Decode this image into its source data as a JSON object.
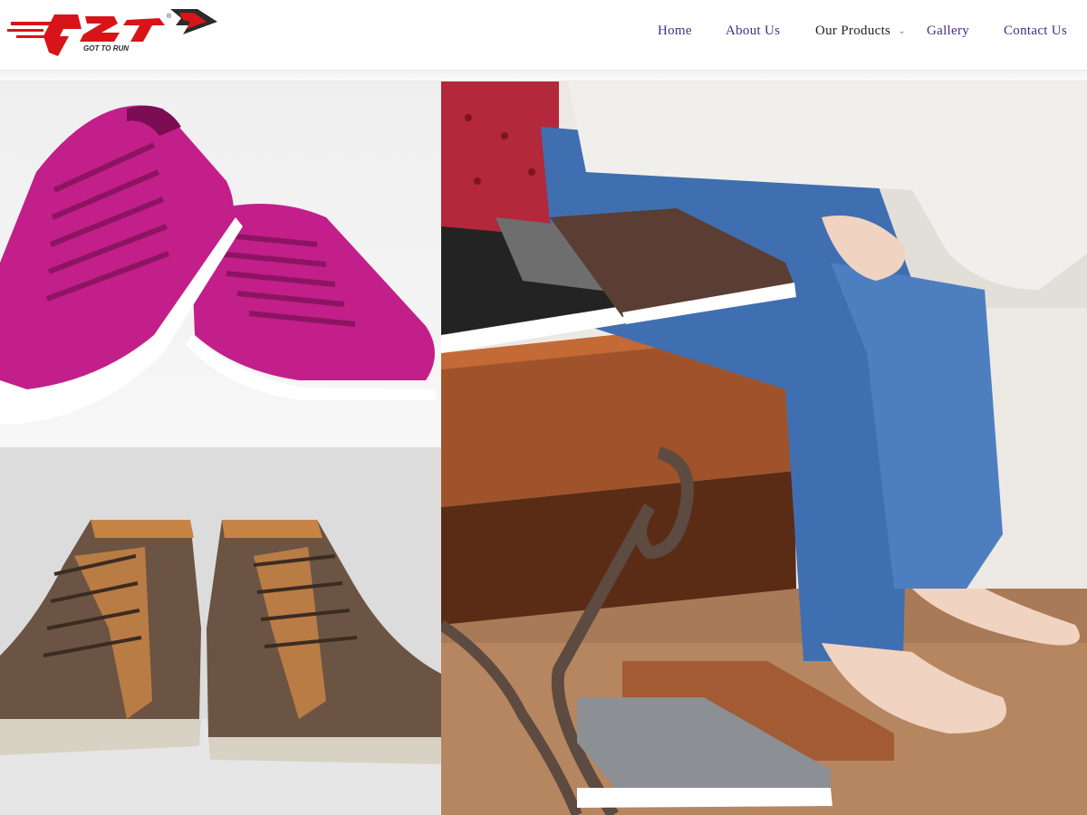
{
  "brand": {
    "logo_text": "G2R",
    "tagline": "GOT TO RUN",
    "registered_mark": "®"
  },
  "nav": {
    "items": [
      {
        "label": "Home"
      },
      {
        "label": "About Us"
      },
      {
        "label": "Our Products",
        "has_dropdown": true,
        "active": true
      },
      {
        "label": "Gallery"
      },
      {
        "label": "Contact Us"
      }
    ],
    "link_color": "#4a2a8a",
    "active_color": "#222222"
  },
  "hero": {
    "images": [
      {
        "name": "pink-sneakers-image",
        "subject": "pair of magenta canvas sneakers"
      },
      {
        "name": "brown-boots-image",
        "subject": "pair of brown leather high-top sneakers"
      },
      {
        "name": "shoe-store-image",
        "subject": "man trying on shoes on a wooden bench"
      }
    ]
  },
  "colors": {
    "logo_red": "#d7141a",
    "logo_dark": "#2b2b2b",
    "magenta": "#c21f8a"
  }
}
